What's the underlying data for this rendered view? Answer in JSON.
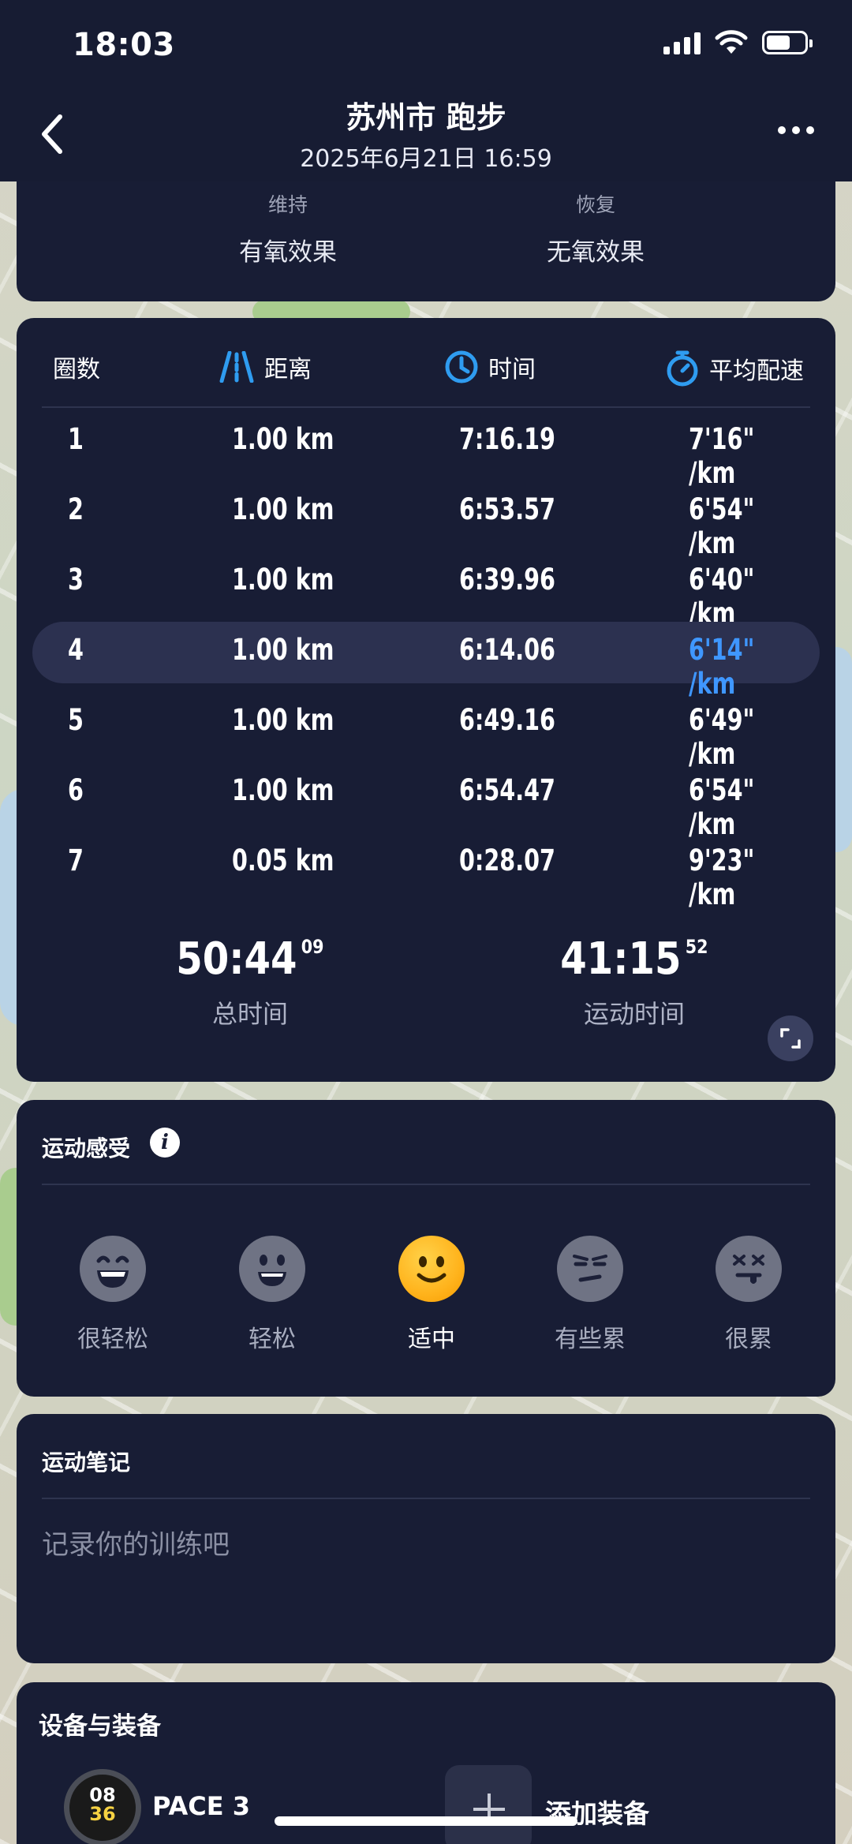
{
  "status_bar": {
    "time": "18:03"
  },
  "header": {
    "title": "苏州市 跑步",
    "subtitle": "2025年6月21日 16:59"
  },
  "effects": {
    "items": [
      {
        "small": "维持",
        "big": "有氧效果"
      },
      {
        "small": "恢复",
        "big": "无氧效果"
      }
    ]
  },
  "laps": {
    "headers": {
      "lap": "圈数",
      "distance": "距离",
      "time": "时间",
      "pace": "平均配速"
    },
    "rows": [
      {
        "lap": "1",
        "distance": "1.00 km",
        "time": "7:16.19",
        "pace": "7'16\" /km"
      },
      {
        "lap": "2",
        "distance": "1.00 km",
        "time": "6:53.57",
        "pace": "6'54\" /km"
      },
      {
        "lap": "3",
        "distance": "1.00 km",
        "time": "6:39.96",
        "pace": "6'40\" /km"
      },
      {
        "lap": "4",
        "distance": "1.00 km",
        "time": "6:14.06",
        "pace": "6'14\" /km",
        "best": true
      },
      {
        "lap": "5",
        "distance": "1.00 km",
        "time": "6:49.16",
        "pace": "6'49\" /km"
      },
      {
        "lap": "6",
        "distance": "1.00 km",
        "time": "6:54.47",
        "pace": "6'54\" /km"
      },
      {
        "lap": "7",
        "distance": "0.05 km",
        "time": "0:28.07",
        "pace": "9'23\" /km"
      }
    ],
    "totals": [
      {
        "value": "50:44",
        "sup": "09",
        "label": "总时间"
      },
      {
        "value": "41:15",
        "sup": "52",
        "label": "运动时间"
      }
    ],
    "best_color": "#3f97ff",
    "accent_icon_color": "#2f9cf0"
  },
  "feeling": {
    "title": "运动感受",
    "options": [
      {
        "label": "很轻松",
        "icon": "very-easy-face-icon",
        "selected": false
      },
      {
        "label": "轻松",
        "icon": "easy-face-icon",
        "selected": false
      },
      {
        "label": "适中",
        "icon": "moderate-face-icon",
        "selected": true
      },
      {
        "label": "有些累",
        "icon": "somewhat-tired-face-icon",
        "selected": false
      },
      {
        "label": "很累",
        "icon": "very-tired-face-icon",
        "selected": false
      }
    ]
  },
  "notes": {
    "title": "运动笔记",
    "placeholder": "记录你的训练吧"
  },
  "devices": {
    "title": "设备与装备",
    "device_name": "PACE 3",
    "watch_face": {
      "line1": "08",
      "line2": "36"
    },
    "add_label": "添加装备"
  }
}
